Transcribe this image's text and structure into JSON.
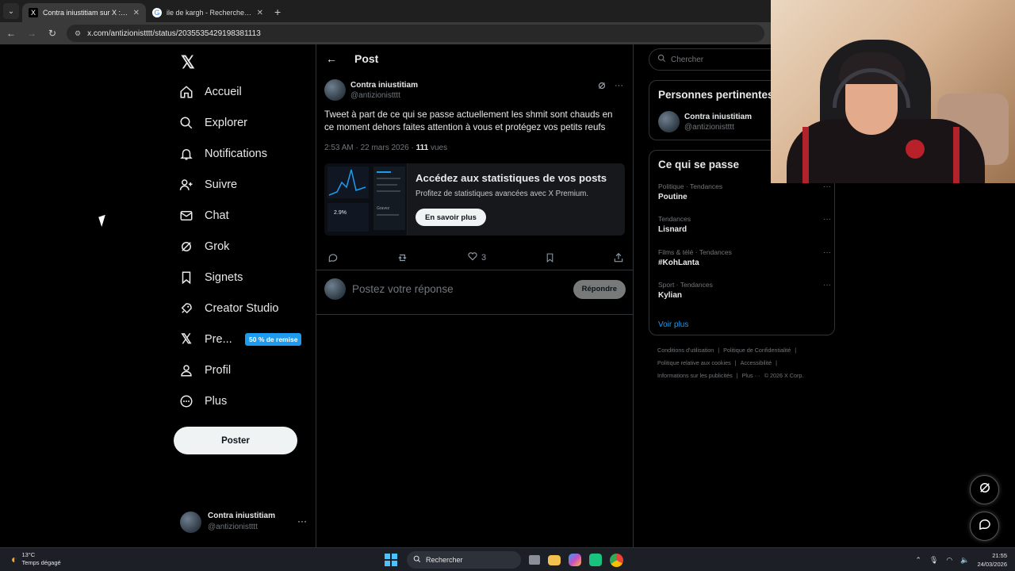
{
  "browser": {
    "tabs": [
      {
        "title": "Contra iniustitiam sur X : \"Twe",
        "active": true,
        "favicon": "X"
      },
      {
        "title": "ile de kargh - Recherche Google",
        "active": false,
        "favicon": "G"
      }
    ],
    "new_tab": "+",
    "url": "x.com/antizionistttt/status/2035535429198381113"
  },
  "nav": {
    "logo": "𝕏",
    "items": [
      {
        "label": "Accueil",
        "icon": "home-icon"
      },
      {
        "label": "Explorer",
        "icon": "search-icon"
      },
      {
        "label": "Notifications",
        "icon": "bell-icon"
      },
      {
        "label": "Suivre",
        "icon": "follow-icon"
      },
      {
        "label": "Chat",
        "icon": "mail-icon"
      },
      {
        "label": "Grok",
        "icon": "grok-icon"
      },
      {
        "label": "Signets",
        "icon": "bookmark-icon"
      },
      {
        "label": "Creator Studio",
        "icon": "rocket-icon"
      },
      {
        "label": "Pre...",
        "icon": "x-premium-icon"
      },
      {
        "label": "Profil",
        "icon": "profile-icon"
      },
      {
        "label": "Plus",
        "icon": "more-circle-icon"
      }
    ],
    "premium_badge": "50 % de remise",
    "post_button": "Poster",
    "account": {
      "name": "Contra iniustitiam",
      "handle": "@antizionistttt",
      "more": "···"
    }
  },
  "post": {
    "header": "Post",
    "author": {
      "name": "Contra iniustitiam",
      "handle": "@antizionistttt"
    },
    "text": "Tweet à part de ce qui se passe actuellement les shmit sont chauds en ce moment dehors faites attention à vous et protégez vos petits reufs",
    "time": "2:53 AM · 22 mars 2026 · ",
    "views_count": "111",
    "views_label": " vues",
    "promo": {
      "heading": "Accédez aux statistiques de vos posts",
      "sub": "Profitez de statistiques avancées avec X Premium.",
      "button": "En savoir plus",
      "thumb_value": "2.9%",
      "thumb_label": "Gravez"
    },
    "likes": "3",
    "reply_placeholder": "Postez votre réponse",
    "reply_button": "Répondre"
  },
  "right": {
    "search_placeholder": "Chercher",
    "people_title": "Personnes pertinentes",
    "person": {
      "name": "Contra iniustitiam",
      "handle": "@antizionistttt"
    },
    "trends_title": "Ce qui se passe",
    "trends": [
      {
        "cat": "Politique · Tendances",
        "name": "Poutine"
      },
      {
        "cat": "Tendances",
        "name": "Lisnard"
      },
      {
        "cat": "Films & télé · Tendances",
        "name": "#KohLanta"
      },
      {
        "cat": "Sport · Tendances",
        "name": "Kylian"
      }
    ],
    "see_more": "Voir plus",
    "footer": [
      "Conditions d'utilisation",
      "|",
      "Politique de Confidentialité",
      "|",
      "Politique relative aux cookies",
      "|",
      "Accessibilité",
      "|",
      "Informations sur les publicités",
      "|",
      "Plus ···",
      "© 2026 X Corp."
    ]
  },
  "taskbar": {
    "temp": "13°C",
    "weather": "Temps dégagé",
    "search": "Rechercher",
    "time": "21:55",
    "date": "24/03/2026"
  },
  "colors": {
    "accent": "#1d9bf0",
    "bg": "#000000",
    "border": "#2f3336",
    "muted": "#71767b"
  }
}
